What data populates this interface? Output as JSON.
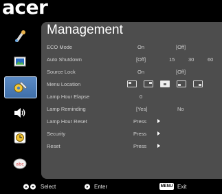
{
  "brand": "acer",
  "menu": {
    "title": "Management",
    "sidebar": [
      {
        "icon": "color-settings-icon",
        "active": false
      },
      {
        "icon": "image-settings-icon",
        "active": false
      },
      {
        "icon": "management-settings-icon",
        "active": true
      },
      {
        "icon": "audio-icon",
        "active": false
      },
      {
        "icon": "timer-icon",
        "active": false
      },
      {
        "icon": "language-icon",
        "active": false
      }
    ],
    "rows": [
      {
        "label": "ECO Mode",
        "values": [
          "On",
          "[Off]"
        ]
      },
      {
        "label": "Auto Shutdown",
        "values": [
          "[Off]",
          "15",
          "30",
          "60"
        ]
      },
      {
        "label": "Source Lock",
        "values": [
          "On",
          "[Off]"
        ]
      },
      {
        "label": "Menu Location",
        "locations": [
          "top-left",
          "top-right",
          "center",
          "bottom-left",
          "bottom-right"
        ],
        "selected": "center"
      },
      {
        "label": "Lamp Hour Elapse",
        "values": [
          "0"
        ]
      },
      {
        "label": "Lamp Reminding",
        "values": [
          "[Yes]",
          "No"
        ]
      },
      {
        "label": "Lamp Hour Reset",
        "values": [
          "Press"
        ]
      },
      {
        "label": "Security",
        "values": [
          "Press"
        ]
      },
      {
        "label": "Reset",
        "values": [
          "Press"
        ]
      }
    ]
  },
  "footer": {
    "select": "Select",
    "enter": "Enter",
    "menu_key": "MENU",
    "exit": "Exit"
  }
}
